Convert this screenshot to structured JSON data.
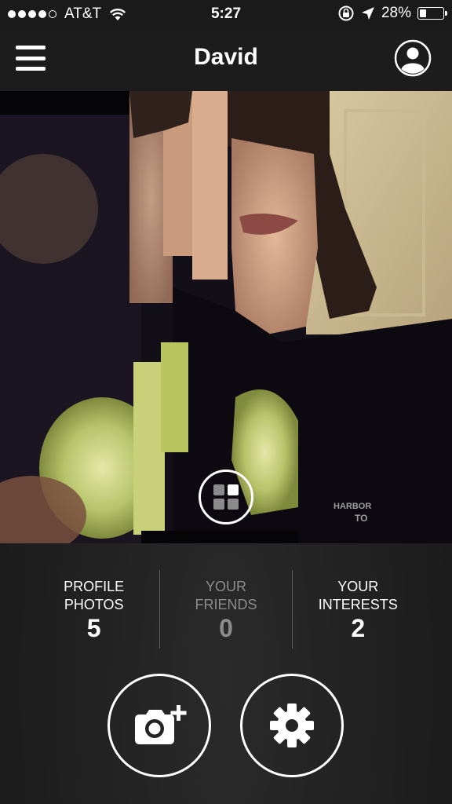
{
  "status_bar": {
    "carrier": "AT&T",
    "time": "5:27",
    "battery": "28%",
    "battery_level": 0.28
  },
  "nav": {
    "title": "David"
  },
  "stats": [
    {
      "label": "PROFILE PHOTOS",
      "value": "5"
    },
    {
      "label": "YOUR FRIENDS",
      "value": "0"
    },
    {
      "label": "YOUR INTERESTS",
      "value": "2"
    }
  ],
  "icons": {
    "menu": "hamburger-menu-icon",
    "profile": "user-icon",
    "gallery": "grid-icon",
    "add_photo": "camera-plus-icon",
    "settings": "gear-icon"
  },
  "colors": {
    "background": "#232323",
    "bar": "#1c1c1c",
    "dim_text": "#8c8c8c"
  }
}
